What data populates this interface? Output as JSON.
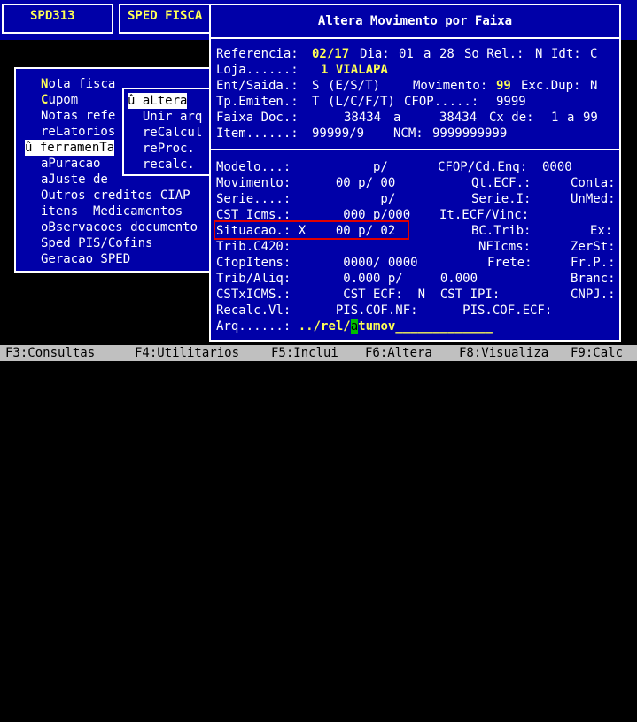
{
  "header": {
    "code": "SPD313",
    "system": "SPED FISCA"
  },
  "menu": {
    "items": [
      {
        "hk": "N",
        "rest": "ota fisca"
      },
      {
        "hk": "C",
        "rest": "upom"
      },
      {
        "hk": "",
        "rest": "Notas refe"
      },
      {
        "hk": "",
        "rest": "reLatorios"
      },
      {
        "hk": "",
        "rest": "û ferramenTa"
      },
      {
        "hk": "",
        "rest": "aPuracao"
      },
      {
        "hk": "",
        "rest": "aJuste de"
      },
      {
        "hk": "",
        "rest": "Outros creditos CIAP"
      },
      {
        "hk": "",
        "rest": "itens  Medicamentos"
      },
      {
        "hk": "",
        "rest": "oBservacoes documento"
      },
      {
        "hk": "",
        "rest": "Sped PIS/Cofins"
      },
      {
        "hk": "",
        "rest": "Geracao SPED"
      }
    ],
    "submenu": [
      "û aLtera",
      "  Unir arq",
      "  reCalcul",
      "  reProc.",
      "  recalc."
    ]
  },
  "dialog": {
    "title": "Altera Movimento por Faixa",
    "ref_label": "Referencia:",
    "ref_val": "02/17",
    "dia_label": "Dia:",
    "dia_from": "01",
    "a1": "a",
    "dia_to": "28",
    "sorel_label": "So Rel.:",
    "sorel_val": "N",
    "idt_label": "Idt:",
    "idt_val": "C",
    "loja_label": "Loja......:",
    "loja_val": "1 VIALAPA",
    "ent_label": "Ent/Saida.:",
    "ent_val": "S",
    "ent_hint": "(E/S/T)",
    "mov_label": "Movimento:",
    "mov_val": "99",
    "exc_label": "Exc.Dup:",
    "exc_val": "N",
    "tp_label": "Tp.Emiten.:",
    "tp_val": "T",
    "tp_hint": "(L/C/F/T)",
    "cfop_label": "CFOP.....:",
    "cfop_val": "9999",
    "faixa_label": "Faixa Doc.:",
    "faixa_from": "38434",
    "a2": "a",
    "faixa_to": "38434",
    "cx_label": "Cx de:",
    "cx_from": "1",
    "a3": "a",
    "cx_to": "99",
    "item_label": "Item......:",
    "item_val": "99999/9",
    "ncm_label": "NCM:",
    "ncm_val": "9999999999",
    "modelo": "Modelo...:           p/",
    "cfopcd": "CFOP/Cd.Enq:",
    "cfopcd_val": "0000",
    "movimento2": "Movimento:      00 p/ 00",
    "qtecf": "Qt.ECF.:",
    "conta": "Conta:",
    "serie": "Serie....:            p/",
    "seriei": "Serie.I:",
    "unmed": "UnMed:",
    "csticms": "CST Icms.:       000 p/000",
    "itecf": "It.ECF/Vinc:",
    "situacao": "Situacao.: X    00 p/ 02",
    "bctrib": "BC.Trib:",
    "ex": "Ex:",
    "tribc420": "Trib.C420:",
    "nficms": "NFIcms:",
    "zerst": "ZerSt:",
    "cfopitens": "CfopItens:       0000/ 0000",
    "frete": "Frete:",
    "frp": "Fr.P.:",
    "tribaliq": "Trib/Aliq:       0.000 p/     0.000",
    "branc": "Branc:",
    "cstxicms": "CSTxICMS.:       CST ECF:  N  CST IPI:",
    "cnpj": "CNPJ.:",
    "recalc": "Recalc.Vl:      PIS.COF.NF:      PIS.COF.ECF:",
    "arq_label": "Arq......:",
    "arq_pre": " ../rel/",
    "arq_cursor": "a",
    "arq_post": "tumov_____________"
  },
  "footer": [
    "F3:Consultas",
    "F4:Utilitarios",
    "F5:Inclui",
    "F6:Altera",
    "F8:Visualiza",
    "F9:Calc"
  ]
}
